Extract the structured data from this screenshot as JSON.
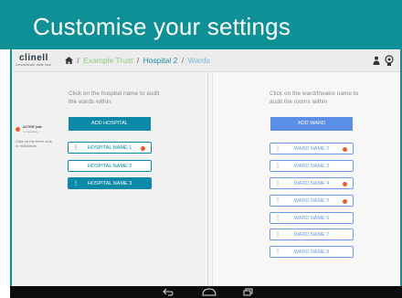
{
  "banner": {
    "title": "Customise your settings"
  },
  "app": {
    "logo": "clinell",
    "logo_tagline": "communicate. audit. train"
  },
  "breadcrumb": {
    "trust": "Example Trust",
    "hospital": "Hospital 2",
    "wards": "Wards",
    "separator": "/"
  },
  "legend": {
    "label": "ACTIVE (site",
    "sublabel": "to complete)",
    "note": "Click on the three dots to edit/delete",
    "dot_color": "#e95a2c"
  },
  "left_panel": {
    "instruction": "Click on the hospital name to audit the wards within",
    "add_button": "ADD HOSPITAL",
    "hospitals": [
      {
        "label": "HOSPITAL NAME 1",
        "active": true,
        "selected": false
      },
      {
        "label": "HOSPITAL NAME 2",
        "active": false,
        "selected": false
      },
      {
        "label": "HOSPITAL NAME 3",
        "active": false,
        "selected": true
      }
    ]
  },
  "right_panel": {
    "instruction": "Click on the ward/theatre name to audit the rooms within",
    "add_button": "ADD WARD",
    "wards": [
      {
        "label": "WARD NAME 2",
        "active": true
      },
      {
        "label": "WARD NAME 3",
        "active": false
      },
      {
        "label": "WARD NAME 4",
        "active": true
      },
      {
        "label": "WARD NAME 5",
        "active": true
      },
      {
        "label": "WARD NAME 6",
        "active": false
      },
      {
        "label": "WARD NAME 7",
        "active": false
      },
      {
        "label": "WARD NAME 8",
        "active": false
      }
    ]
  },
  "colors": {
    "brand_teal": "#0f8f96",
    "primary": "#0a88a7",
    "ward_blue": "#5b8ee6",
    "active_dot": "#e95a2c"
  }
}
